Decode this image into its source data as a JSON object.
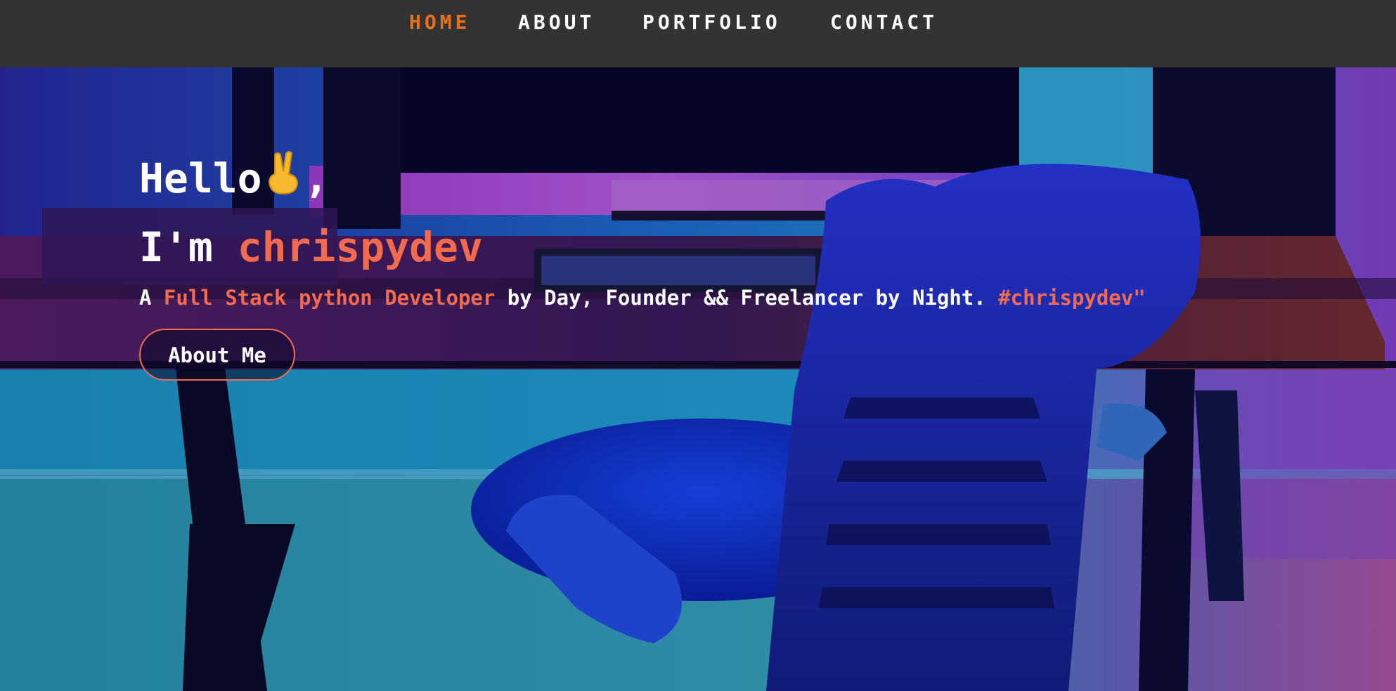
{
  "nav": {
    "items": [
      {
        "label": "HOME",
        "active": true
      },
      {
        "label": "ABOUT",
        "active": false
      },
      {
        "label": "PORTFOLIO",
        "active": false
      },
      {
        "label": "CONTACT",
        "active": false
      }
    ]
  },
  "hero": {
    "greeting": "Hello",
    "greeting_icon": "victory-hand-icon",
    "greeting_punct": ",",
    "intro_prefix": "I'm ",
    "name": "chrispydev",
    "tagline": {
      "prefix": "A ",
      "highlight": "Full Stack python Developer",
      "middle": " by Day, Founder && Freelancer by Night. ",
      "hashtag": "#chrispydev\""
    },
    "cta_label": "About Me",
    "background": "desk-setup-photo"
  },
  "colors": {
    "nav_bg": "#333333",
    "nav_active": "#e8701a",
    "accent": "#f26b50",
    "text": "#ffffff"
  }
}
